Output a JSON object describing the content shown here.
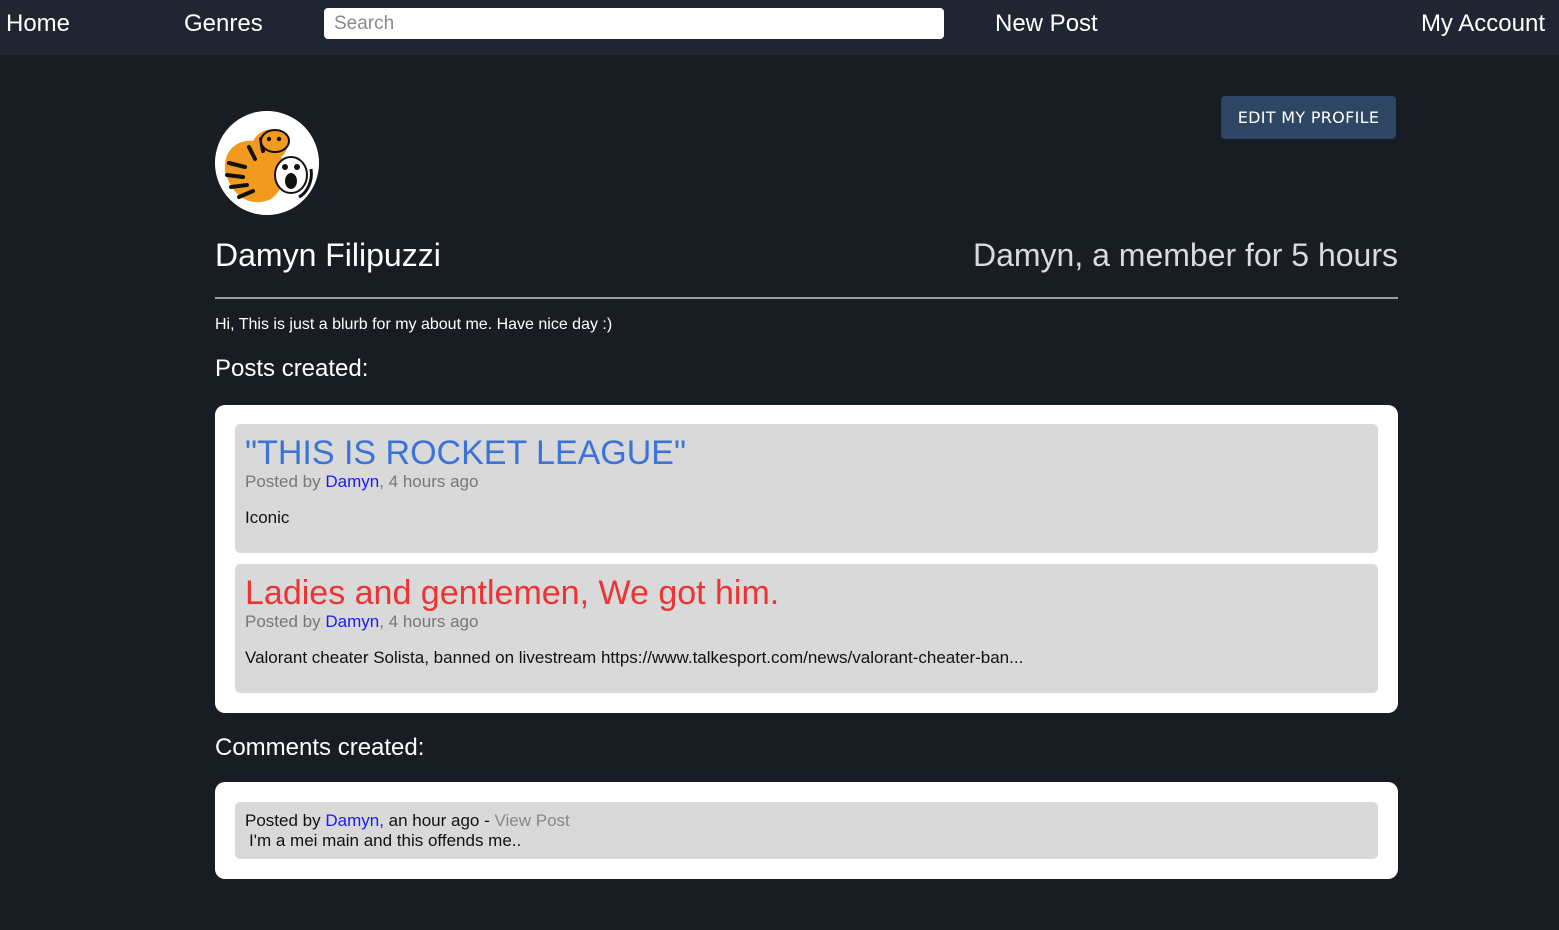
{
  "nav": {
    "home": "Home",
    "genres": "Genres",
    "search_placeholder": "Search",
    "new_post": "New Post",
    "my_account": "My Account"
  },
  "profile": {
    "edit_button": "EDIT MY PROFILE",
    "name": "Damyn Filipuzzi",
    "member_text": "Damyn, a member for 5 hours",
    "about": "Hi, This is just a blurb for my about me. Have nice day :)",
    "avatar_icon": "tiger-avatar-icon"
  },
  "posts_section": {
    "heading": "Posts created:",
    "posts": [
      {
        "title": "\"THIS IS ROCKET LEAGUE\"",
        "title_color": "#3b73d9",
        "posted_by": "Posted by",
        "author": "Damyn",
        "time": ", 4 hours ago",
        "body": "Iconic"
      },
      {
        "title": "Ladies and gentlemen, We got him.",
        "title_color": "#ee3333",
        "posted_by": "Posted by",
        "author": "Damyn",
        "time": ", 4 hours ago",
        "body": "Valorant cheater Solista, banned on livestream https://www.talkesport.com/news/valorant-cheater-ban..."
      }
    ]
  },
  "comments_section": {
    "heading": "Comments created:",
    "comments": [
      {
        "posted_by": "Posted by",
        "author": "Damyn,",
        "time": " an hour ago - ",
        "view_post": "View Post",
        "body": "I'm a mei main and this offends me.."
      }
    ]
  },
  "colors": {
    "background": "#181c23",
    "navbar": "#202631",
    "edit_button": "#2e4663",
    "card": "#d9d9d9",
    "author_link": "#1a1aff"
  }
}
